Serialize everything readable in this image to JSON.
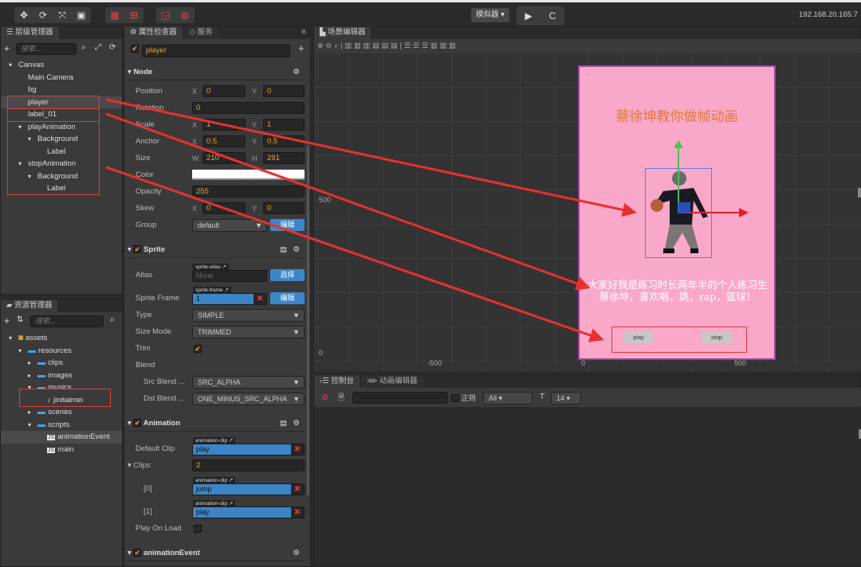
{
  "toolbar": {
    "transform_tools": [
      "move-icon",
      "rotate-icon",
      "scale-icon",
      "rect-icon"
    ],
    "simulator_label": "模拟器 ▾",
    "ip": "192.168.20.165:7"
  },
  "hierarchy": {
    "title": "层级管理器",
    "search_placeholder": "搜索...",
    "nodes": [
      {
        "label": "Canvas",
        "depth": 0,
        "arrow": "▾"
      },
      {
        "label": "Main Camera",
        "depth": 1,
        "arrow": ""
      },
      {
        "label": "bg",
        "depth": 1,
        "arrow": ""
      },
      {
        "label": "player",
        "depth": 1,
        "arrow": "",
        "selected": true
      },
      {
        "label": "label_01",
        "depth": 1,
        "arrow": ""
      },
      {
        "label": "playAnimation",
        "depth": 1,
        "arrow": "▾"
      },
      {
        "label": "Background",
        "depth": 2,
        "arrow": "▾"
      },
      {
        "label": "Label",
        "depth": 3,
        "arrow": ""
      },
      {
        "label": "stopAnimation",
        "depth": 1,
        "arrow": "▾"
      },
      {
        "label": "Background",
        "depth": 2,
        "arrow": "▾"
      },
      {
        "label": "Label",
        "depth": 3,
        "arrow": ""
      }
    ]
  },
  "assets": {
    "title": "资源管理器",
    "search_placeholder": "搜索...",
    "items": [
      {
        "label": "assets",
        "depth": 0,
        "arrow": "▾",
        "icon": "assets-db-icon"
      },
      {
        "label": "resources",
        "depth": 1,
        "arrow": "▾",
        "icon": "folder-icon"
      },
      {
        "label": "clips",
        "depth": 2,
        "arrow": "▸",
        "icon": "folder-icon"
      },
      {
        "label": "images",
        "depth": 2,
        "arrow": "▸",
        "icon": "folder-icon"
      },
      {
        "label": "musics",
        "depth": 2,
        "arrow": "▾",
        "icon": "folder-icon"
      },
      {
        "label": "jinitaimei",
        "depth": 3,
        "arrow": "",
        "icon": "audio-icon"
      },
      {
        "label": "scenes",
        "depth": 2,
        "arrow": "▸",
        "icon": "folder-icon"
      },
      {
        "label": "scripts",
        "depth": 2,
        "arrow": "▾",
        "icon": "folder-icon"
      },
      {
        "label": "animationEvent",
        "depth": 3,
        "arrow": "",
        "icon": "js-file-icon",
        "selected": true
      },
      {
        "label": "main",
        "depth": 3,
        "arrow": "",
        "icon": "js-file-icon"
      }
    ]
  },
  "inspector": {
    "tab": "属性检查器",
    "tab2": "服务",
    "node_name": "player",
    "node": {
      "title": "Node",
      "position": {
        "label": "Position",
        "x": "0",
        "y": "0"
      },
      "rotation": {
        "label": "Rotation",
        "value": "0"
      },
      "scale": {
        "label": "Scale",
        "x": "1",
        "y": "1"
      },
      "anchor": {
        "label": "Anchor",
        "x": "0.5",
        "y": "0.5"
      },
      "size": {
        "label": "Size",
        "w": "210",
        "h": "291"
      },
      "color": {
        "label": "Color",
        "value": "#ffffff"
      },
      "opacity": {
        "label": "Opacity",
        "value": "255"
      },
      "skew": {
        "label": "Skew",
        "x": "0",
        "y": "0"
      },
      "group": {
        "label": "Group",
        "value": "default",
        "edit": "编辑"
      }
    },
    "sprite": {
      "title": "Sprite",
      "atlas": {
        "label": "Atlas",
        "tag": "sprite-atlas",
        "value": "None",
        "button": "选择"
      },
      "frame": {
        "label": "Sprite Frame",
        "tag": "sprite-frame",
        "value": "1",
        "button": "编辑"
      },
      "type": {
        "label": "Type",
        "value": "SIMPLE"
      },
      "size_mode": {
        "label": "Size Mode",
        "value": "TRIMMED"
      },
      "trim": {
        "label": "Trim",
        "checked": true
      },
      "blend": "Blend",
      "src": {
        "label": "Src Blend ...",
        "value": "SRC_ALPHA"
      },
      "dst": {
        "label": "Dst Blend ...",
        "value": "ONE_MINUS_SRC_ALPHA"
      }
    },
    "animation": {
      "title": "Animation",
      "default_clip": {
        "label": "Default Clip",
        "tag": "animation-clip",
        "value": "play"
      },
      "clips": {
        "label": "Clips",
        "count": "2"
      },
      "clip0": {
        "label": "[0]",
        "tag": "animation-clip",
        "value": "jump"
      },
      "clip1": {
        "label": "[1]",
        "tag": "animation-clip",
        "value": "play"
      },
      "play_on_load": {
        "label": "Play On Load",
        "checked": false
      }
    },
    "script": {
      "title": "animationEvent"
    }
  },
  "scene": {
    "tab": "场景编辑器",
    "axis": {
      "y500": "500",
      "y0": "0",
      "xm500": "-500",
      "x0": "0",
      "x500": "500"
    },
    "title_text": "蔡徐坤教你做帧动画",
    "intro_text": "大家好我是练习时长两年半的个人练习生蔡徐坤，喜欢唱，跳，rap，篮球！",
    "play_button": "play",
    "stop_button": "stop",
    "canvas_color": "#f9a8c9",
    "title_color": "#e07a3a"
  },
  "console": {
    "tab": "控制台",
    "tab2": "动画编辑器",
    "regex_label": "正则",
    "level": "All ▾",
    "font_size": "14 ▾"
  },
  "colors": {
    "accent": "#e8a23c",
    "annotation": "#e23b3b",
    "button_blue": "#3c87c9"
  }
}
